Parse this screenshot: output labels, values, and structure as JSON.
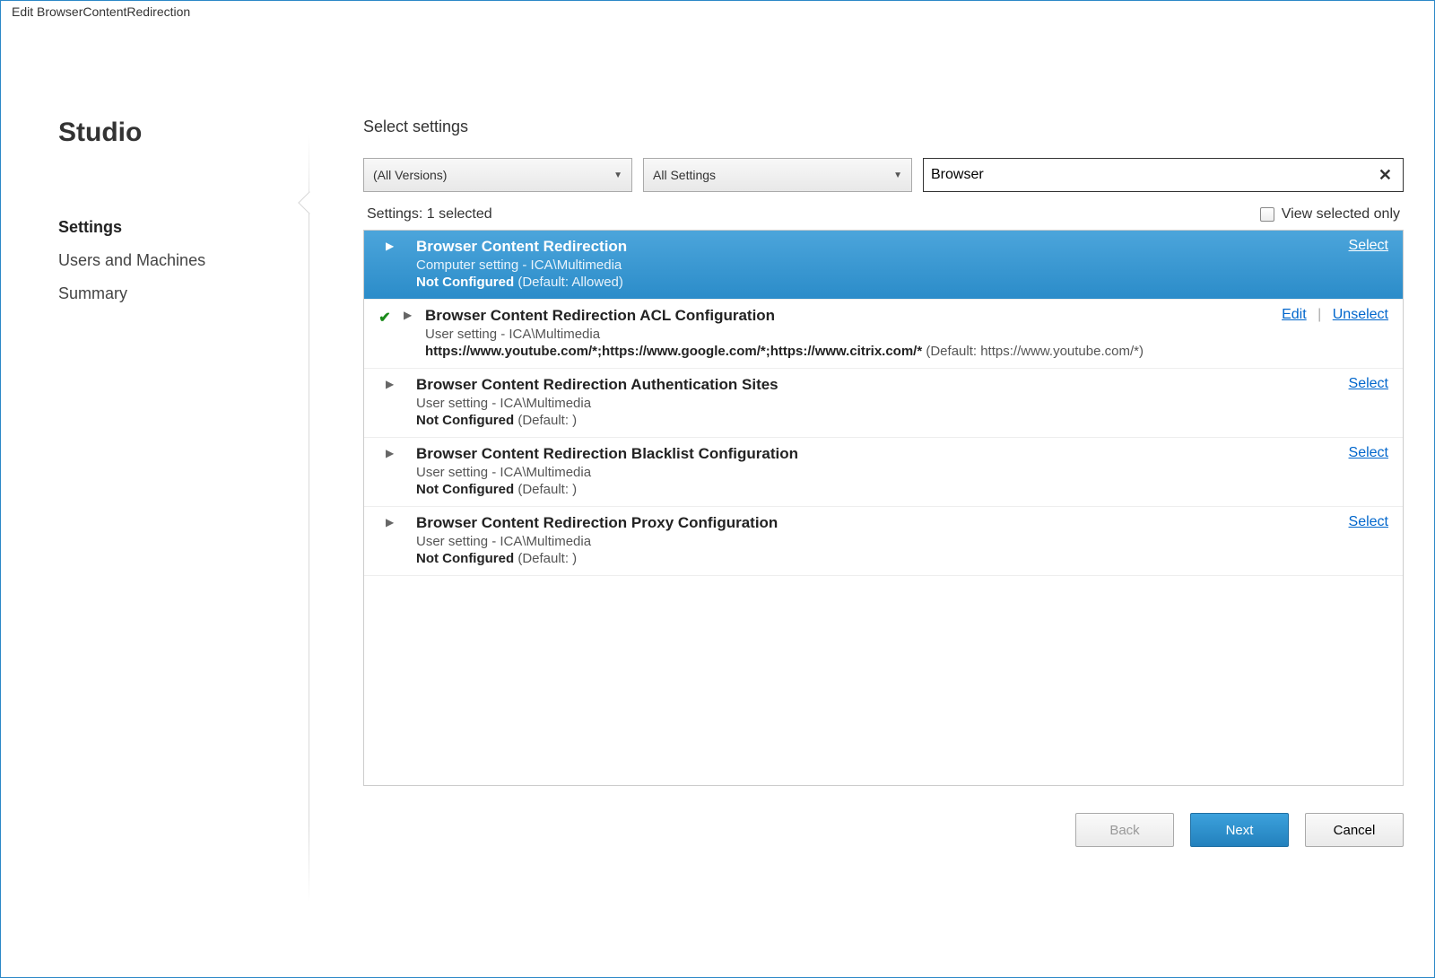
{
  "window": {
    "title": "Edit BrowserContentRedirection"
  },
  "sidebar": {
    "brand": "Studio",
    "items": [
      {
        "label": "Settings",
        "active": true
      },
      {
        "label": "Users and Machines",
        "active": false
      },
      {
        "label": "Summary",
        "active": false
      }
    ]
  },
  "main": {
    "section_title": "Select settings",
    "filters": {
      "version": "(All Versions)",
      "scope": "All Settings",
      "search_value": "Browser"
    },
    "status": {
      "label": "Settings:",
      "count_text": "1 selected",
      "view_only_label": "View selected only"
    },
    "settings": [
      {
        "title": "Browser Content Redirection",
        "meta": "Computer setting - ICA\\Multimedia",
        "status_prefix": "Not Configured",
        "status_suffix": " (Default: Allowed)",
        "selected": true,
        "checked": false,
        "actions": {
          "primary": "Select"
        }
      },
      {
        "title": "Browser Content Redirection ACL Configuration",
        "meta": "User setting - ICA\\Multimedia",
        "status_prefix": "https://www.youtube.com/*;https://www.google.com/*;https://www.citrix.com/*",
        "status_suffix": " (Default: https://www.youtube.com/*)",
        "selected": false,
        "checked": true,
        "actions": {
          "edit": "Edit",
          "unselect": "Unselect"
        }
      },
      {
        "title": "Browser Content Redirection Authentication Sites",
        "meta": "User setting - ICA\\Multimedia",
        "status_prefix": "Not Configured",
        "status_suffix": " (Default: )",
        "selected": false,
        "checked": false,
        "actions": {
          "primary": "Select"
        }
      },
      {
        "title": "Browser Content Redirection Blacklist Configuration",
        "meta": "User setting - ICA\\Multimedia",
        "status_prefix": "Not Configured",
        "status_suffix": " (Default: )",
        "selected": false,
        "checked": false,
        "actions": {
          "primary": "Select"
        }
      },
      {
        "title": "Browser Content Redirection Proxy Configuration",
        "meta": "User setting - ICA\\Multimedia",
        "status_prefix": "Not Configured",
        "status_suffix": " (Default: )",
        "selected": false,
        "checked": false,
        "actions": {
          "primary": "Select"
        }
      }
    ],
    "buttons": {
      "back": "Back",
      "next": "Next",
      "cancel": "Cancel"
    }
  }
}
